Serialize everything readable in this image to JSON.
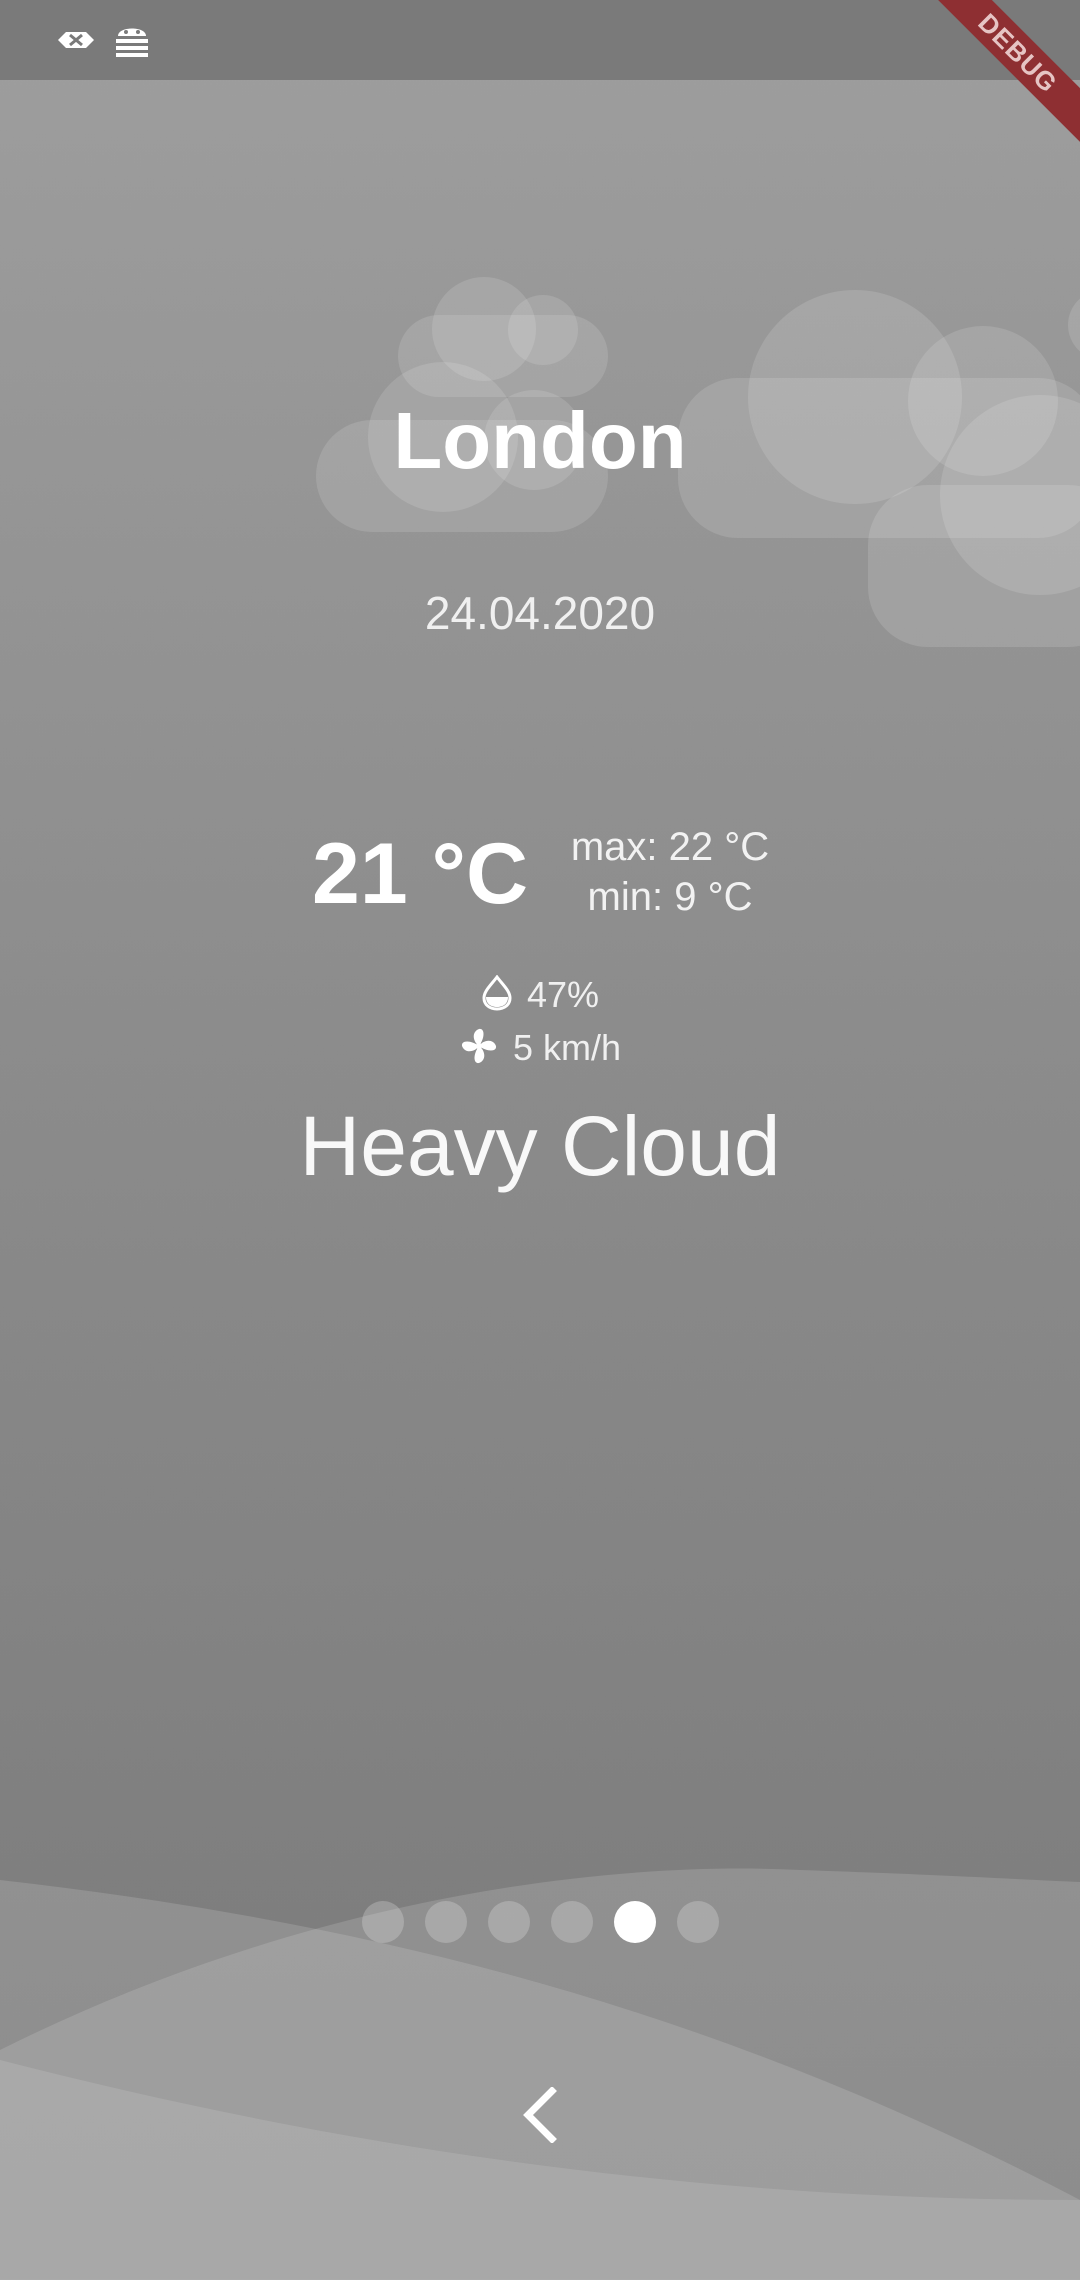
{
  "debug_banner": "DEBUG",
  "weather": {
    "city": "London",
    "date": "24.04.2020",
    "temperature": "21 °C",
    "max": "max: 22 °C",
    "min": "min: 9 °C",
    "humidity": "47%",
    "wind": "5 km/h",
    "condition": "Heavy Cloud"
  },
  "pager": {
    "total": 6,
    "active_index": 4
  },
  "icons": {
    "status_left": "usb-debug-icon",
    "status_right": "android-debug-icon",
    "humidity": "droplet-icon",
    "wind": "fan-icon",
    "back": "chevron-left-icon"
  },
  "colors": {
    "background": "#8c8c8c",
    "debug_ribbon": "#8e2f32",
    "text": "#ffffff"
  }
}
